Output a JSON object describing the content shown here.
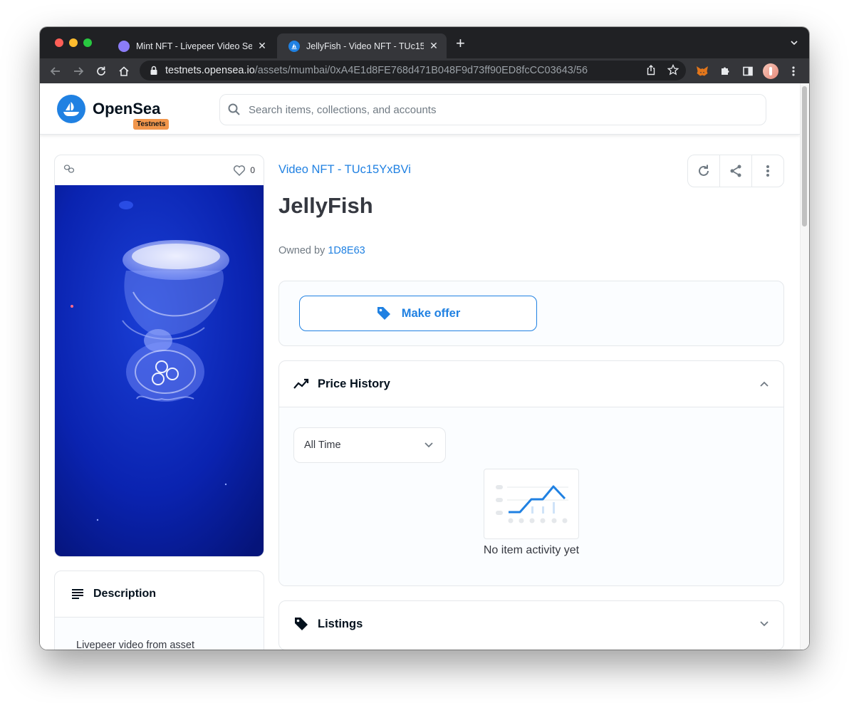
{
  "browser": {
    "tabs": [
      {
        "title": "Mint NFT - Livepeer Video Serv",
        "active": false,
        "favicon_color": "#8b7cf6"
      },
      {
        "title": "JellyFish - Video NFT - TUc15Y",
        "active": true,
        "favicon_color": "#2081e2"
      }
    ],
    "url_host": "testnets.opensea.io",
    "url_path": "/assets/mumbai/0xA4E1d8FE768d471B048F9d73ff90ED8fcCC03643/56"
  },
  "header": {
    "logo_text": "OpenSea",
    "badge": "Testnets",
    "search_placeholder": "Search items, collections, and accounts"
  },
  "asset": {
    "likes": "0",
    "collection": "Video NFT - TUc15YxBVi",
    "title": "JellyFish",
    "owned_prefix": "Owned by ",
    "owner": "1D8E63"
  },
  "offer": {
    "button_label": "Make offer"
  },
  "price_history": {
    "title": "Price History",
    "range_selected": "All Time",
    "empty_text": "No item activity yet"
  },
  "listings": {
    "title": "Listings"
  },
  "description": {
    "title": "Description",
    "text": "Livepeer video from asset"
  },
  "colors": {
    "brand": "#2081e2",
    "badge": "#f1964b",
    "chrome_dark": "#202124"
  }
}
